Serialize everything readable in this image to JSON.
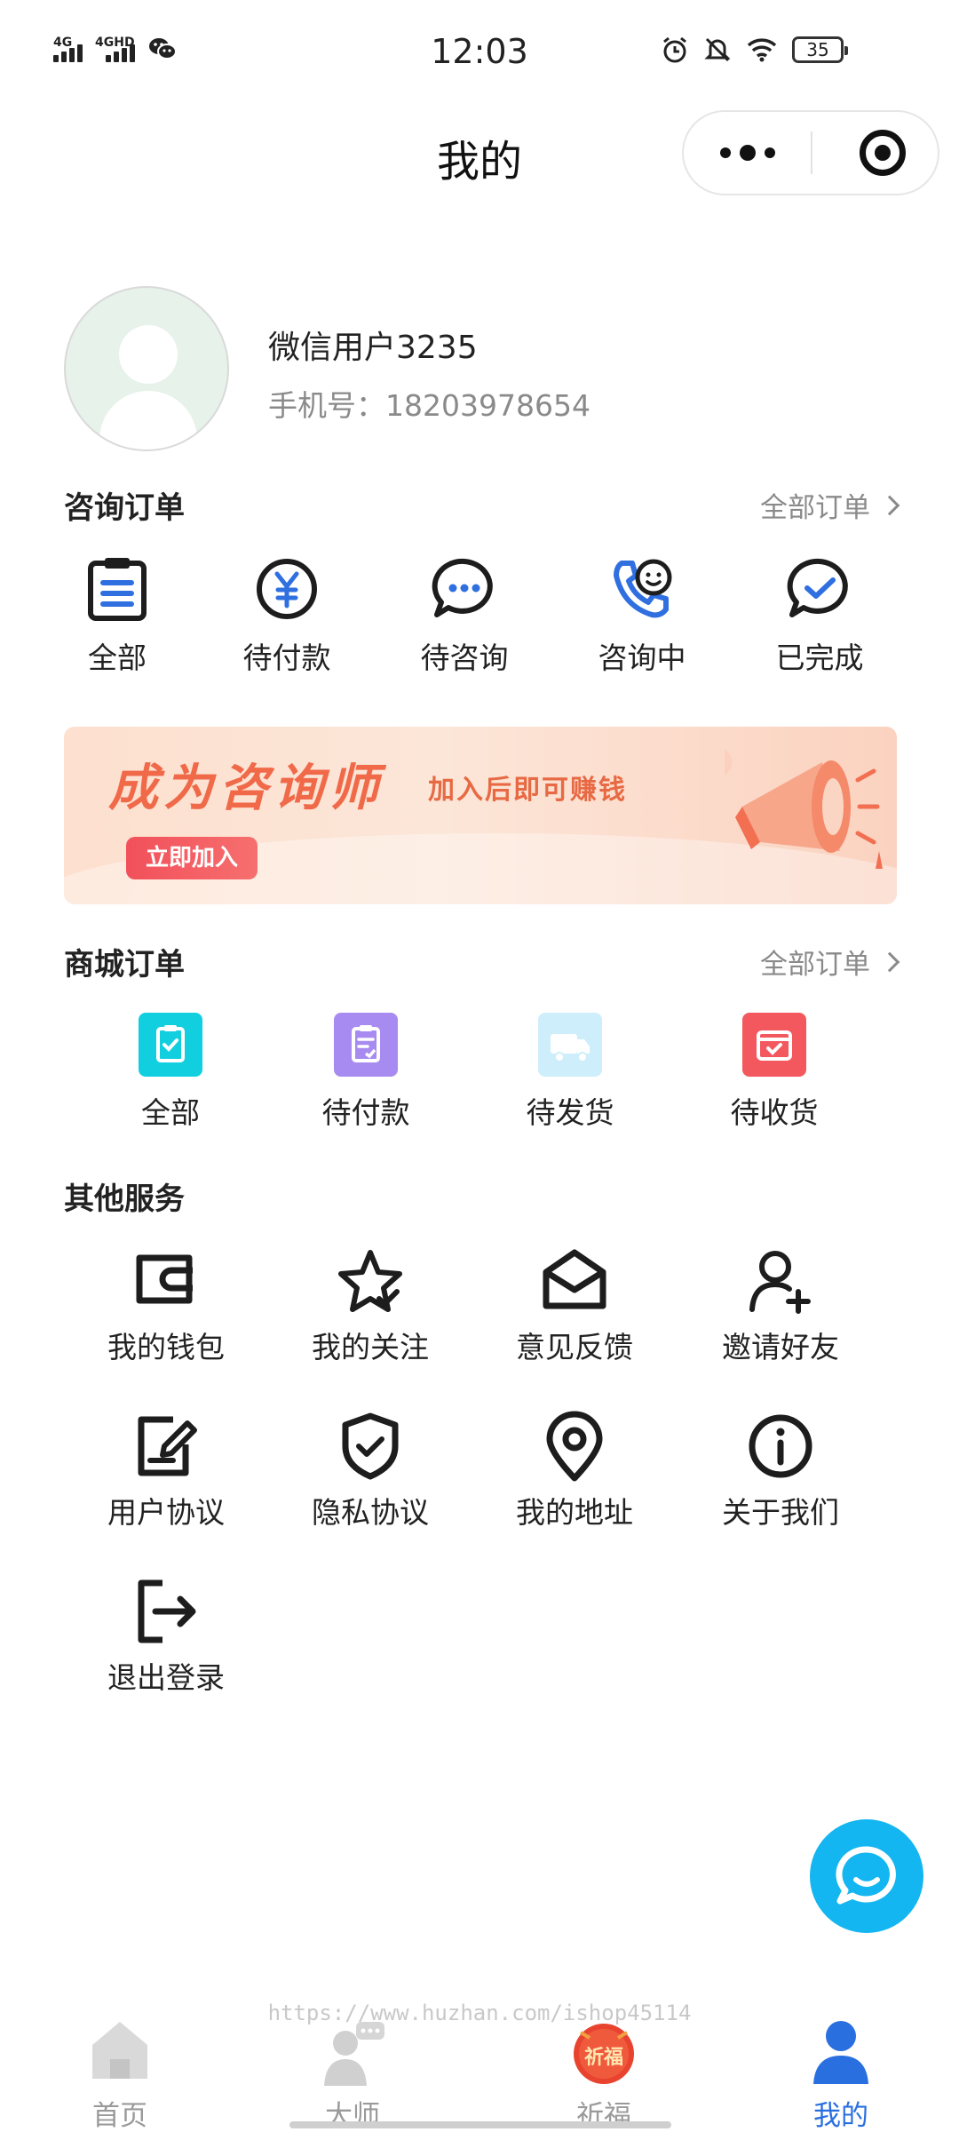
{
  "status_bar": {
    "time": "12:03",
    "signal1": "4G",
    "signal2": "4GHD",
    "battery": "35"
  },
  "nav": {
    "title": "我的"
  },
  "profile": {
    "name": "微信用户3235",
    "phone": "手机号：18203978654"
  },
  "consult_orders": {
    "title": "咨询订单",
    "more": "全部订单",
    "items": [
      {
        "label": "全部",
        "icon": "clipboard-icon"
      },
      {
        "label": "待付款",
        "icon": "yen-icon"
      },
      {
        "label": "待咨询",
        "icon": "chat-dots-icon"
      },
      {
        "label": "咨询中",
        "icon": "phone-smile-icon"
      },
      {
        "label": "已完成",
        "icon": "chat-check-icon"
      }
    ]
  },
  "banner": {
    "title": "成为咨询师",
    "subtitle": "加入后即可赚钱",
    "button": "立即加入"
  },
  "shop_orders": {
    "title": "商城订单",
    "more": "全部订单",
    "items": [
      {
        "label": "全部",
        "icon": "checklist-icon",
        "color": "#12cfe0"
      },
      {
        "label": "待付款",
        "icon": "payment-doc-icon",
        "color": "#a78bf0"
      },
      {
        "label": "待发货",
        "icon": "truck-icon",
        "color": "#cdeefa"
      },
      {
        "label": "待收货",
        "icon": "box-check-icon",
        "color": "#f2585e"
      }
    ]
  },
  "services": {
    "title": "其他服务",
    "items": [
      {
        "label": "我的钱包",
        "icon": "wallet-icon"
      },
      {
        "label": "我的关注",
        "icon": "star-check-icon"
      },
      {
        "label": "意见反馈",
        "icon": "mail-icon"
      },
      {
        "label": "邀请好友",
        "icon": "add-user-icon"
      },
      {
        "label": "用户协议",
        "icon": "edit-doc-icon"
      },
      {
        "label": "隐私协议",
        "icon": "shield-check-icon"
      },
      {
        "label": "我的地址",
        "icon": "location-pin-icon"
      },
      {
        "label": "关于我们",
        "icon": "info-icon"
      },
      {
        "label": "退出登录",
        "icon": "logout-icon"
      }
    ]
  },
  "watermark": "https://www.huzhan.com/ishop45114",
  "tabbar": {
    "items": [
      {
        "label": "首页",
        "icon": "home-icon"
      },
      {
        "label": "大师",
        "icon": "master-icon"
      },
      {
        "label": "祈福",
        "icon": "blessing-icon",
        "badge": "祈福"
      },
      {
        "label": "我的",
        "icon": "profile-icon"
      }
    ],
    "active_color": "#2a6fe0"
  }
}
